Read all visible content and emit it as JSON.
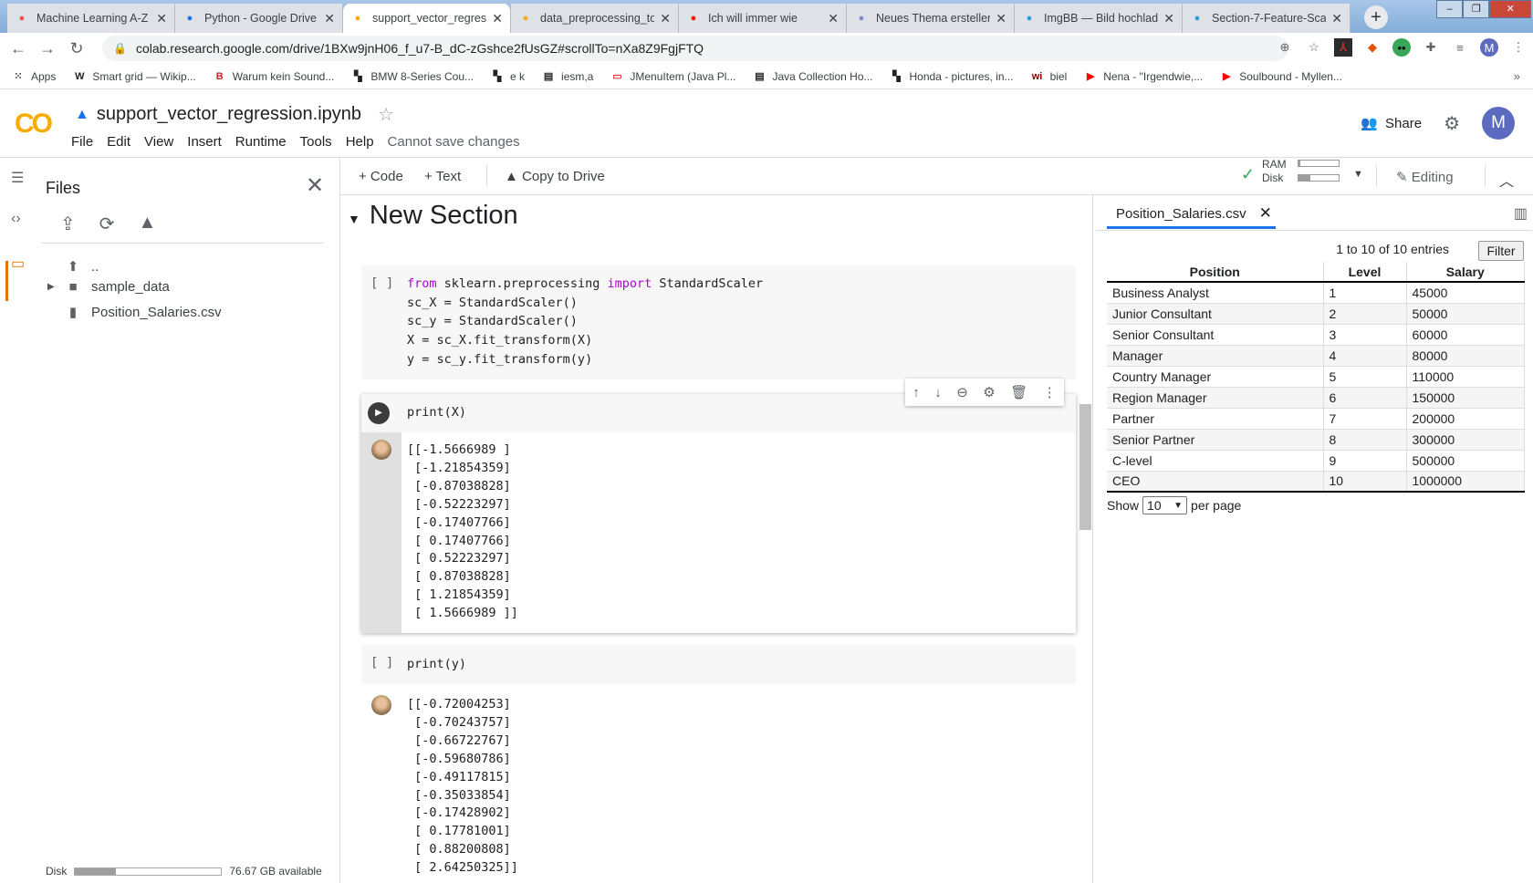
{
  "browser": {
    "tabs": [
      {
        "title": "Machine Learning A-Z",
        "icon": "udemy-icon",
        "color": "#ec5252"
      },
      {
        "title": "Python - Google Drive",
        "icon": "drive-icon",
        "color": "#1a73e8"
      },
      {
        "title": "support_vector_regress",
        "icon": "colab-icon",
        "color": "#f9ab00",
        "active": true
      },
      {
        "title": "data_preprocessing_to",
        "icon": "colab-icon",
        "color": "#f9ab00"
      },
      {
        "title": "Ich will immer wie",
        "icon": "youtube-icon",
        "color": "#ff0000"
      },
      {
        "title": "Neues Thema erstellen",
        "icon": "forum-icon",
        "color": "#7b8fc7"
      },
      {
        "title": "ImgBB — Bild hochlad",
        "icon": "imgbb-icon",
        "color": "#2a9fd8"
      },
      {
        "title": "Section-7-Feature-Scal",
        "icon": "imgbb-icon",
        "color": "#2a9fd8"
      }
    ],
    "url": "colab.research.google.com/drive/1BXw9jnH06_f_u7-B_dC-zGshce2fUsGZ#scrollTo=nXa8Z9FgjFTQ",
    "profile_initial": "M",
    "bookmarks": [
      {
        "label": "Apps",
        "icon": "apps-grid-icon"
      },
      {
        "label": "Smart grid — Wikip...",
        "icon": "wikipedia-icon"
      },
      {
        "label": "Warum kein Sound...",
        "icon": "b-icon"
      },
      {
        "label": "BMW 8-Series Cou...",
        "icon": "checker-icon"
      },
      {
        "label": "e k",
        "icon": "checker-icon"
      },
      {
        "label": "iesm,a",
        "icon": "page-icon"
      },
      {
        "label": "JMenuItem (Java Pl...",
        "icon": "oracle-icon"
      },
      {
        "label": "Java Collection Ho...",
        "icon": "page-icon"
      },
      {
        "label": "Honda - pictures, in...",
        "icon": "checker-icon"
      },
      {
        "label": "biel",
        "icon": "wi-icon"
      },
      {
        "label": "Nena - \"Irgendwie,...",
        "icon": "youtube-icon"
      },
      {
        "label": "Soulbound - Myllen...",
        "icon": "youtube-icon"
      }
    ]
  },
  "colab": {
    "notebook_title": "support_vector_regression.ipynb",
    "menu": [
      "File",
      "Edit",
      "View",
      "Insert",
      "Runtime",
      "Tools",
      "Help"
    ],
    "save_note": "Cannot save changes",
    "share": "Share",
    "avatar": "M",
    "toolbar": {
      "code": "+ Code",
      "text": "+ Text",
      "copy": "Copy to Drive",
      "ram": "RAM",
      "disk": "Disk",
      "ram_usage": 0.05,
      "disk_usage": 0.3,
      "editing": "Editing"
    }
  },
  "sidebar": {
    "title": "Files",
    "items": [
      {
        "name": "..",
        "type": "parent"
      },
      {
        "name": "sample_data",
        "type": "folder"
      },
      {
        "name": "Position_Salaries.csv",
        "type": "file"
      }
    ],
    "disk_label": "Disk",
    "disk_usage": 0.28,
    "disk_available": "76.67 GB available"
  },
  "notebook": {
    "section_title": "New Section",
    "cell1_bracket": "[ ]",
    "cell1_lines": [
      "sc_X = StandardScaler()",
      "sc_y = StandardScaler()",
      "X = sc_X.fit_transform(X)",
      "y = sc_y.fit_transform(y)"
    ],
    "cell1_first": {
      "kw1": "from",
      "mod": " sklearn.preprocessing ",
      "kw2": "import",
      "name": " StandardScaler"
    },
    "cell2_code": "print(X)",
    "cell2_output": "[[-1.5666989 ]\n [-1.21854359]\n [-0.87038828]\n [-0.52223297]\n [-0.17407766]\n [ 0.17407766]\n [ 0.52223297]\n [ 0.87038828]\n [ 1.21854359]\n [ 1.5666989 ]]",
    "cell3_bracket": "[ ]",
    "cell3_code": "print(y)",
    "cell3_output": "[[-0.72004253]\n [-0.70243757]\n [-0.66722767]\n [-0.59680786]\n [-0.49117815]\n [-0.35033854]\n [-0.17428902]\n [ 0.17781001]\n [ 0.88200808]\n [ 2.64250325]]"
  },
  "panel": {
    "tab": "Position_Salaries.csv",
    "entries": "1 to 10 of 10 entries",
    "filter": "Filter",
    "columns": [
      "Position",
      "Level",
      "Salary"
    ],
    "rows": [
      [
        "Business Analyst",
        "1",
        "45000"
      ],
      [
        "Junior Consultant",
        "2",
        "50000"
      ],
      [
        "Senior Consultant",
        "3",
        "60000"
      ],
      [
        "Manager",
        "4",
        "80000"
      ],
      [
        "Country Manager",
        "5",
        "110000"
      ],
      [
        "Region Manager",
        "6",
        "150000"
      ],
      [
        "Partner",
        "7",
        "200000"
      ],
      [
        "Senior Partner",
        "8",
        "300000"
      ],
      [
        "C-level",
        "9",
        "500000"
      ],
      [
        "CEO",
        "10",
        "1000000"
      ]
    ],
    "show": "Show",
    "per_page_value": "10",
    "per_page": "per page"
  }
}
